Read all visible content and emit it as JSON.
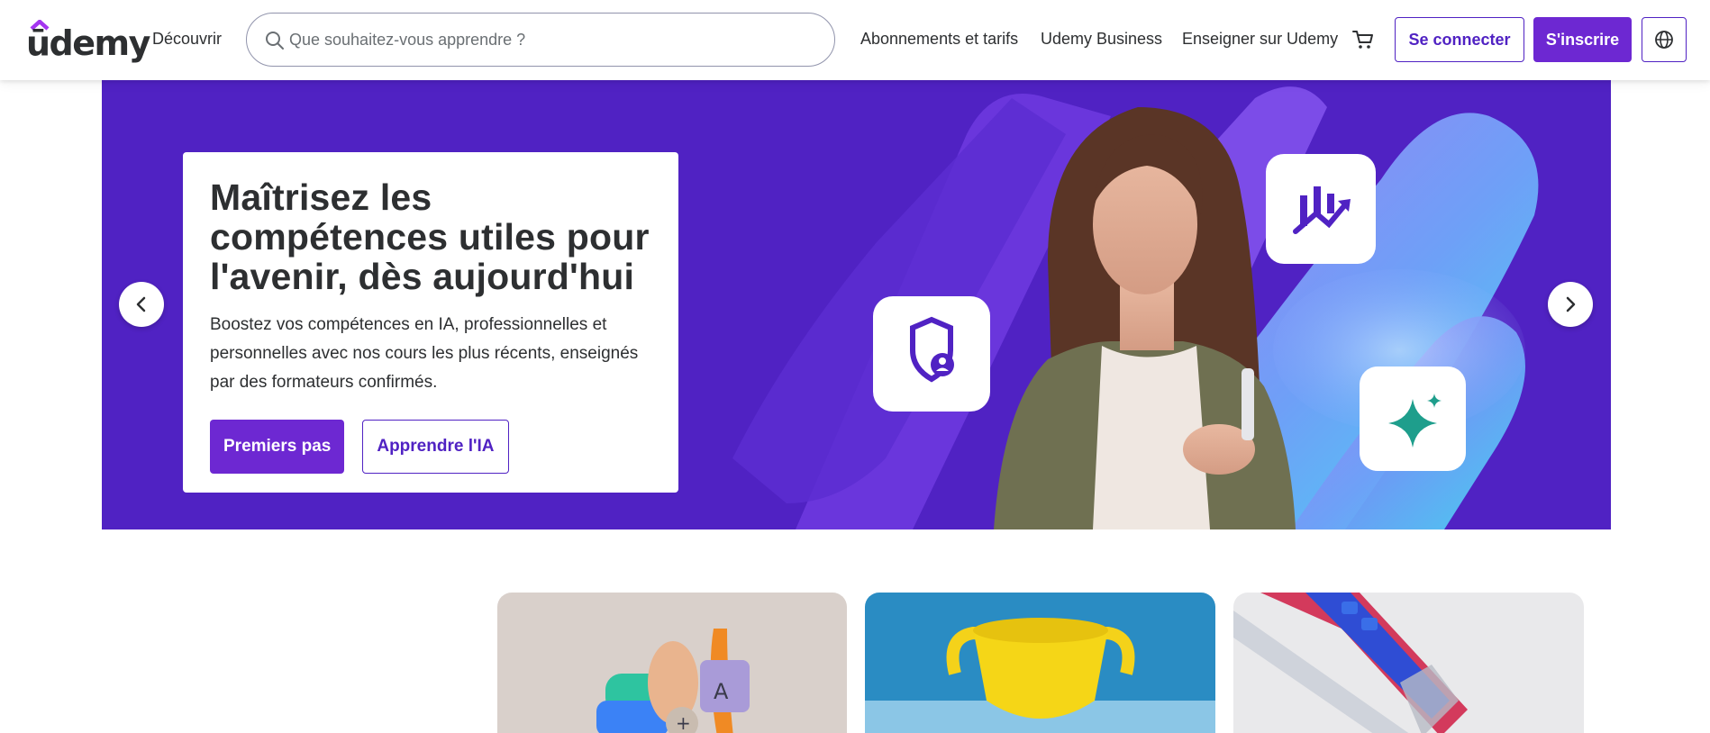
{
  "header": {
    "logo_text": "ūdemy",
    "explore_label": "Découvrir",
    "search": {
      "placeholder": "Que souhaitez-vous apprendre ?",
      "value": "",
      "icon": "search-icon"
    },
    "nav": {
      "plans_label": "Abonnements et tarifs",
      "business_label": "Udemy Business",
      "teach_label": "Enseigner sur Udemy"
    },
    "cart_icon": "cart-icon",
    "login_label": "Se connecter",
    "signup_label": "S'inscrire",
    "language_icon": "globe-icon"
  },
  "hero": {
    "title": "Maîtrisez les compétences utiles pour l'avenir, dès aujourd'hui",
    "subtitle": "Boostez vos compétences en IA, professionnelles et personnelles avec nos cours les plus récents, enseignés par des formateurs confirmés.",
    "primary_button": "Premiers pas",
    "secondary_button": "Apprendre l'IA",
    "prev_icon": "chevron-left-icon",
    "next_icon": "chevron-right-icon",
    "floating_icons": [
      "shield-user-icon",
      "chart-trend-icon",
      "sparkle-icon"
    ]
  },
  "colors": {
    "brand_purple": "#6d28d2",
    "hero_bg": "#5022c3",
    "teal_sparkle": "#1e9e8c"
  }
}
